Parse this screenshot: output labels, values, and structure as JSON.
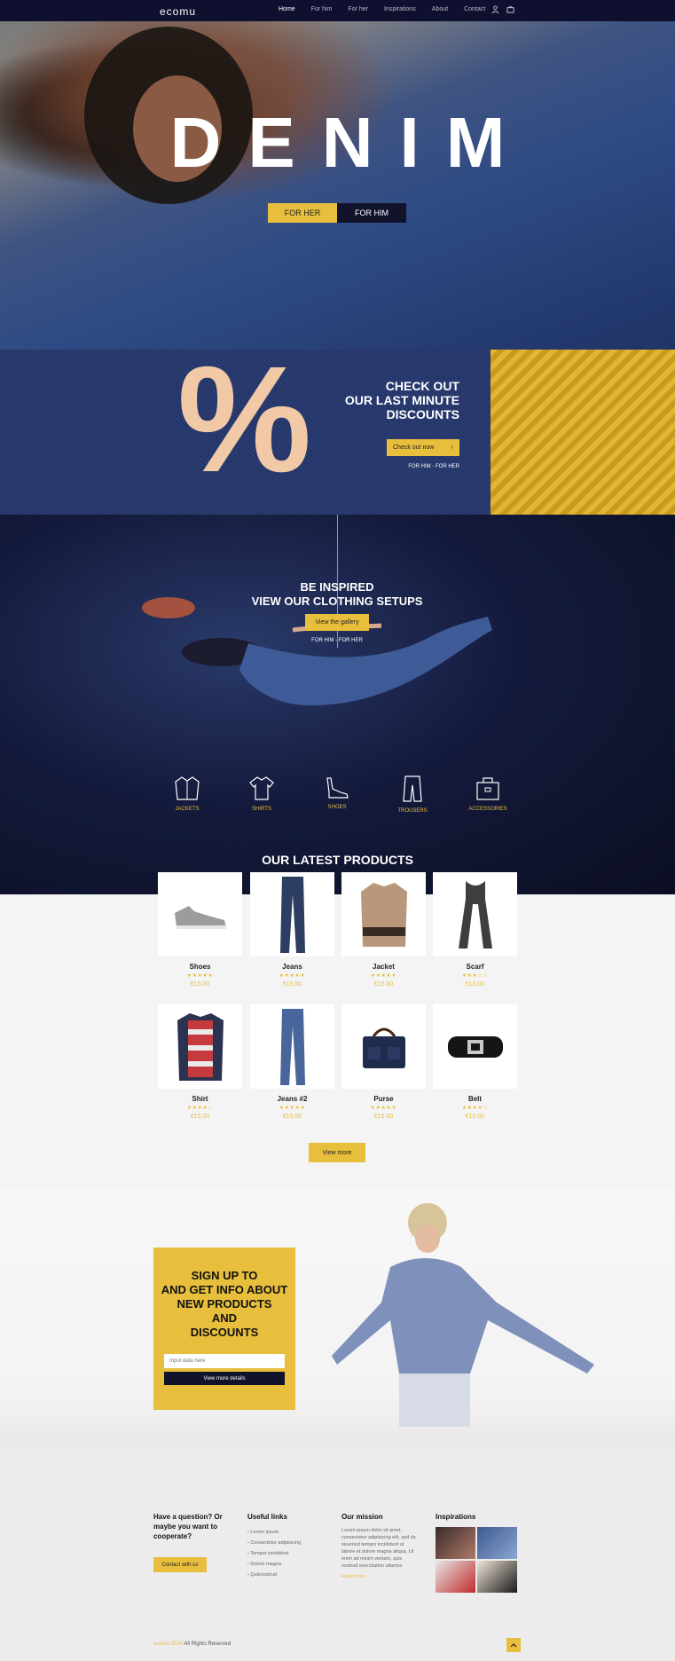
{
  "brand": "ecomu",
  "nav": {
    "items": [
      "Home",
      "For him",
      "For her",
      "Inspirations",
      "About",
      "Contact"
    ]
  },
  "hero": {
    "title": "DENIM",
    "btn_her": "FOR HER",
    "btn_him": "FOR HIM"
  },
  "discount": {
    "symbol": "%",
    "line1": "CHECK OUT",
    "line2": "OUR LAST MINUTE",
    "line3": "DISCOUNTS",
    "button": "Check out now",
    "sub": "FOR HIM - FOR HER"
  },
  "inspired": {
    "line1": "BE INSPIRED",
    "line2": "VIEW OUR CLOTHING SETUPS",
    "button": "View the gallery",
    "sub": "FOR HIM - FOR HER",
    "categories": [
      "JACKETS",
      "SHIRTS",
      "SHOES",
      "TROUSERS",
      "ACCESSORIES"
    ]
  },
  "products": {
    "title": "OUR LATEST PRODUCTS",
    "items": [
      {
        "name": "Shoes",
        "rating": 5,
        "price": "€15.00"
      },
      {
        "name": "Jeans",
        "rating": 5,
        "price": "€15.00"
      },
      {
        "name": "Jacket",
        "rating": 5,
        "price": "€15.00"
      },
      {
        "name": "Scarf",
        "rating": 3,
        "price": "€15.00"
      },
      {
        "name": "Shirt",
        "rating": 4,
        "price": "€15.00"
      },
      {
        "name": "Jeans #2",
        "rating": 5,
        "price": "€15.00"
      },
      {
        "name": "Purse",
        "rating": 5,
        "price": "€15.00"
      },
      {
        "name": "Belt",
        "rating": 4,
        "price": "€15.00"
      }
    ],
    "view_more": "View more"
  },
  "signup": {
    "line1": "SIGN UP TO",
    "line2": "AND GET INFO ABOUT",
    "line3": "NEW PRODUCTS",
    "line4": "AND",
    "line5": "DISCOUNTS",
    "placeholder": "Input data here",
    "button": "View more details"
  },
  "footer": {
    "question": "Have a question? Or maybe you want to cooperate?",
    "contact_button": "Contact with us",
    "links_title": "Useful links",
    "links": [
      "Lorem ipsum",
      "Consectetur adipisicing",
      "Tempor incididunt",
      "Dolore magna",
      "Quisnostrud"
    ],
    "mission_title": "Our mission",
    "mission_text": "Lorem ipsum dolor sit amet, consectetur adipisicing elit, sed do eiusmod tempor incididunt ut labore et dolore magna aliqua. Ut enim ad minim veniam, quis nostrud exercitation ullamco",
    "read_more": "Read more",
    "inspirations_title": "Inspirations",
    "copyright_brand": "ecomu 2024",
    "copyright_rest": " All Rights Reserved"
  }
}
